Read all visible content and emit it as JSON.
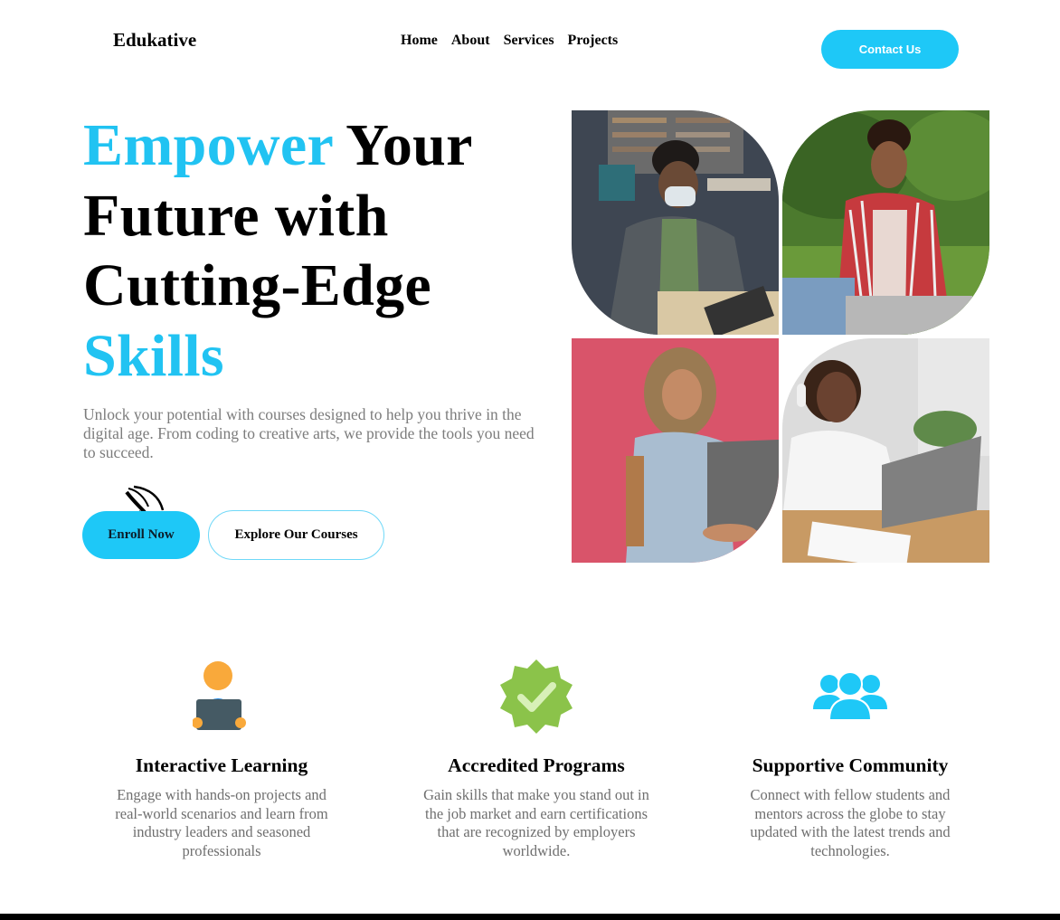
{
  "header": {
    "logo": "Edukative",
    "nav": [
      "Home",
      "About",
      "Services",
      "Projects"
    ],
    "contact_label": "Contact Us"
  },
  "hero": {
    "title_highlight_1": "Empower",
    "title_mid": " Your Future with Cutting-Edge ",
    "title_highlight_2": "Skills",
    "description": "Unlock your potential with courses designed to help you thrive in the digital age. From coding to creative arts, we provide the tools you need to succeed.",
    "primary_cta": "Enroll Now",
    "secondary_cta": "Explore Our Courses"
  },
  "features": [
    {
      "icon": "student-laptop-icon",
      "title": "Interactive Learning",
      "text": "Engage with hands-on projects and real-world scenarios and learn from industry leaders and seasoned professionals"
    },
    {
      "icon": "verified-badge-icon",
      "title": "Accredited Programs",
      "text": "Gain skills that make you stand out in the job market and earn certifications that are recognized by employers worldwide."
    },
    {
      "icon": "community-group-icon",
      "title": "Supportive Community",
      "text": "Connect with fellow students and mentors across the globe to stay updated with the latest trends and technologies."
    }
  ],
  "colors": {
    "accent": "#21c3f2",
    "button": "#1ec8f7",
    "badge_green": "#8bc34a",
    "avatar_orange": "#f9a93b",
    "laptop_slate": "#455a64"
  }
}
